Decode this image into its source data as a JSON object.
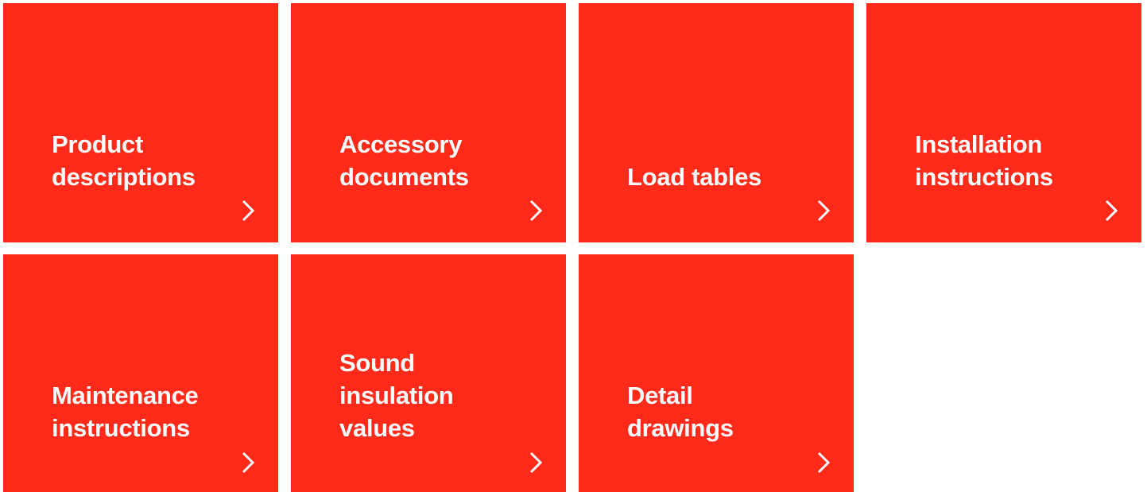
{
  "tiles": [
    {
      "lines": [
        "Product",
        "descriptions"
      ],
      "icon": "chevron-right-icon"
    },
    {
      "lines": [
        "Accessory",
        "documents"
      ],
      "icon": "chevron-right-icon"
    },
    {
      "lines": [
        "Load tables"
      ],
      "icon": "chevron-right-icon"
    },
    {
      "lines": [
        "Installation",
        "instructions"
      ],
      "icon": "chevron-right-icon"
    },
    {
      "lines": [
        "Maintenance",
        "instructions"
      ],
      "icon": "chevron-right-icon"
    },
    {
      "lines": [
        "Sound",
        "insulation",
        "values"
      ],
      "icon": "chevron-right-icon"
    },
    {
      "lines": [
        "Detail",
        "drawings"
      ],
      "icon": "chevron-right-icon"
    }
  ],
  "colors": {
    "tile_background": "#ff2a1a",
    "tile_text": "#ffffff",
    "page_background": "#ffffff"
  }
}
